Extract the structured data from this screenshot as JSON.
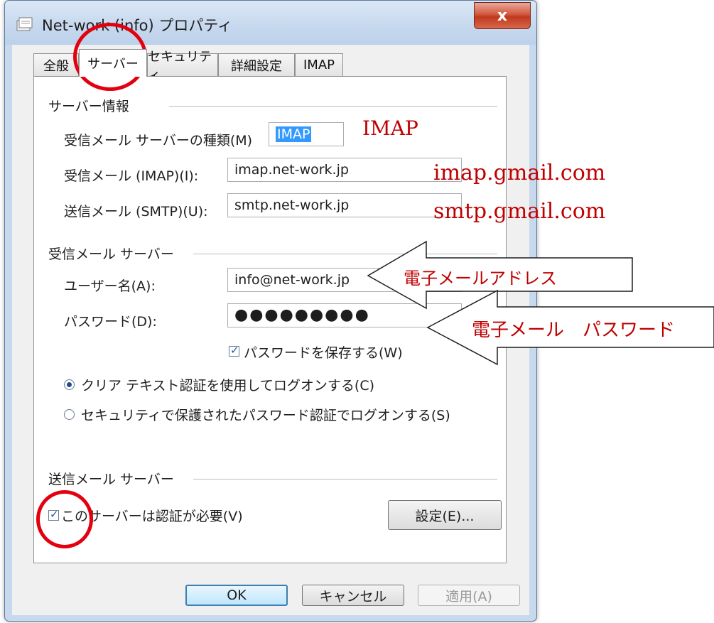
{
  "window": {
    "title": "Net-work (info) プロパティ",
    "close_symbol": "x"
  },
  "tabs": [
    {
      "label": "全般"
    },
    {
      "label": "サーバー"
    },
    {
      "label": "セキュリティ"
    },
    {
      "label": "詳細設定"
    },
    {
      "label": "IMAP"
    }
  ],
  "server_info": {
    "heading": "サーバー情報",
    "type_label": "受信メール サーバーの種類(M)",
    "type_value": "IMAP",
    "incoming_label": "受信メール (IMAP)(I):",
    "incoming_value": "imap.net-work.jp",
    "outgoing_label": "送信メール (SMTP)(U):",
    "outgoing_value": "smtp.net-work.jp"
  },
  "incoming_server": {
    "heading": "受信メール サーバー",
    "username_label": "ユーザー名(A):",
    "username_value": "info@net-work.jp",
    "password_label": "パスワード(D):",
    "password_value": "●●●●●●●●●",
    "save_password_label": "パスワードを保存する(W)",
    "save_password_checked": true,
    "radio_clear_text": "クリア テキスト認証を使用してログオンする(C)",
    "radio_secure": "セキュリティで保護されたパスワード認証でログオンする(S)",
    "selected_radio": "clear_text"
  },
  "outgoing_server": {
    "heading": "送信メール サーバー",
    "auth_required_label": "このサーバーは認証が必要(V)",
    "auth_required_checked": true,
    "settings_button": "設定(E)..."
  },
  "buttons": {
    "ok": "OK",
    "cancel": "キャンセル",
    "apply": "適用(A)"
  },
  "annotations": {
    "imap": "IMAP",
    "imap_server": "imap.gmail.com",
    "smtp_server": "smtp.gmail.com",
    "email_address": "電子メールアドレス",
    "email_password": "電子メール　パスワード"
  },
  "colors": {
    "annotation_red": "#c00000",
    "circle_red": "#e3000f",
    "selection_blue": "#3399ff"
  }
}
